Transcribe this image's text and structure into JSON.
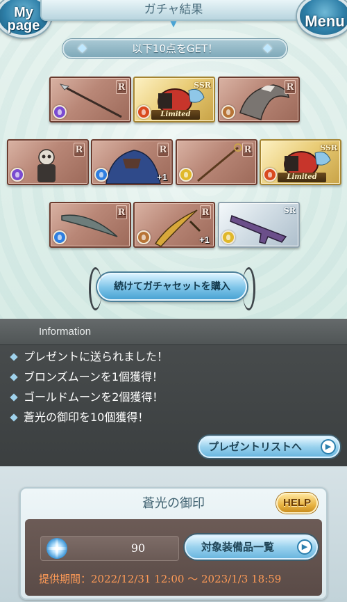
{
  "header": {
    "title": "ガチャ結果",
    "mypage_label_line1": "My",
    "mypage_label_line2": "page",
    "menu_label": "Menu"
  },
  "banner": {
    "text": "以下10点をGET！"
  },
  "cards": [
    {
      "rarity": "R",
      "element": "dark",
      "element_color": "#7a4bd1",
      "art": "spear",
      "limited": "",
      "plus": ""
    },
    {
      "rarity": "SSR",
      "element": "fire",
      "element_color": "#d94a1f",
      "art": "red-gauntlet",
      "limited": "Limited",
      "plus": ""
    },
    {
      "rarity": "R",
      "element": "earth",
      "element_color": "#b77436",
      "art": "eagle",
      "limited": "",
      "plus": ""
    },
    {
      "rarity": "R",
      "element": "dark",
      "element_color": "#7a4bd1",
      "art": "skeleton",
      "limited": "",
      "plus": ""
    },
    {
      "rarity": "R",
      "element": "water",
      "element_color": "#2f7fe0",
      "art": "blue-beast",
      "limited": "",
      "plus": "+1"
    },
    {
      "rarity": "R",
      "element": "light",
      "element_color": "#e0b82a",
      "art": "staff",
      "limited": "",
      "plus": ""
    },
    {
      "rarity": "SSR",
      "element": "fire",
      "element_color": "#d94a1f",
      "art": "red-gauntlet",
      "limited": "Limited",
      "plus": ""
    },
    {
      "rarity": "R",
      "element": "water",
      "element_color": "#2f7fe0",
      "art": "curved-blade",
      "limited": "",
      "plus": ""
    },
    {
      "rarity": "R",
      "element": "earth",
      "element_color": "#b77436",
      "art": "golden-sword",
      "limited": "",
      "plus": "+1"
    },
    {
      "rarity": "SR",
      "element": "light",
      "element_color": "#e0b82a",
      "art": "purple-gun",
      "limited": "",
      "plus": ""
    }
  ],
  "continue_button": {
    "label": "続けてガチャセットを購入"
  },
  "information": {
    "title": "Information",
    "items": [
      "プレゼントに送られました！",
      "ブロンズムーンを1個獲得！",
      "ゴールドムーンを2個獲得！",
      "蒼光の御印を10個獲得！"
    ],
    "present_list_label": "プレゼントリストへ"
  },
  "seal": {
    "title": "蒼光の御印",
    "help_label": "HELP",
    "count": "90",
    "equipment_list_label": "対象装備品一覧",
    "period": "提供期間：2022/12/31 12:00 ～ 2023/1/3 18:59"
  },
  "colors": {
    "accent_blue": "#4aa3d3",
    "period_text": "#ff9b57",
    "info_bg": "#3b3f40"
  }
}
